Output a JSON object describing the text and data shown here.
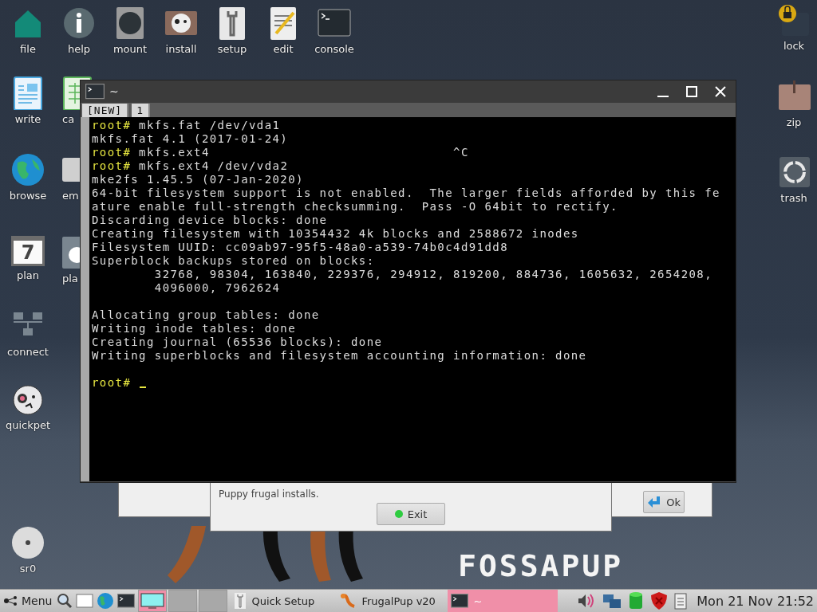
{
  "desktop_icons": [
    {
      "label": "file"
    },
    {
      "label": "help"
    },
    {
      "label": "mount"
    },
    {
      "label": "install"
    },
    {
      "label": "setup"
    },
    {
      "label": "edit"
    },
    {
      "label": "console"
    },
    {
      "label": "lock"
    },
    {
      "label": "write"
    },
    {
      "label": "ca"
    },
    {
      "label": "zip"
    },
    {
      "label": "browse"
    },
    {
      "label": "em"
    },
    {
      "label": "trash"
    },
    {
      "label": "plan",
      "glyph": "7"
    },
    {
      "label": "pla"
    },
    {
      "label": "connect"
    },
    {
      "label": "quickpet"
    },
    {
      "label": "sr0"
    }
  ],
  "dialogs": [
    {
      "text": "Puppy frugal installs.",
      "button": "Exit"
    },
    {
      "button": "Ok"
    }
  ],
  "terminal": {
    "title": "~",
    "tabs": [
      {
        "label": "[NEW]"
      },
      {
        "label": "1"
      }
    ],
    "lines": [
      {
        "kind": "prompt",
        "prompt": "root#",
        "command": "mkfs.fat /dev/vda1"
      },
      {
        "kind": "output",
        "text": "mkfs.fat 4.1 (2017-01-24)"
      },
      {
        "kind": "prompt",
        "prompt": "root#",
        "command": "mkfs.ext4                               ^C"
      },
      {
        "kind": "prompt",
        "prompt": "root#",
        "command": "mkfs.ext4 /dev/vda2"
      },
      {
        "kind": "output",
        "text": "mke2fs 1.45.5 (07-Jan-2020)"
      },
      {
        "kind": "output",
        "text": "64-bit filesystem support is not enabled.  The larger fields afforded by this fe"
      },
      {
        "kind": "output",
        "text": "ature enable full-strength checksumming.  Pass -O 64bit to rectify."
      },
      {
        "kind": "output",
        "text": "Discarding device blocks: done"
      },
      {
        "kind": "output",
        "text": "Creating filesystem with 10354432 4k blocks and 2588672 inodes"
      },
      {
        "kind": "output",
        "text": "Filesystem UUID: cc09ab97-95f5-48a0-a539-74b0c4d91dd8"
      },
      {
        "kind": "output",
        "text": "Superblock backups stored on blocks:"
      },
      {
        "kind": "indented",
        "text": "32768, 98304, 163840, 229376, 294912, 819200, 884736, 1605632, 2654208,"
      },
      {
        "kind": "indented",
        "text": "4096000, 7962624"
      },
      {
        "kind": "blank"
      },
      {
        "kind": "output",
        "text": "Allocating group tables: done"
      },
      {
        "kind": "output",
        "text": "Writing inode tables: done"
      },
      {
        "kind": "output",
        "text": "Creating journal (65536 blocks): done"
      },
      {
        "kind": "output",
        "text": "Writing superblocks and filesystem accounting information: done"
      },
      {
        "kind": "blank"
      },
      {
        "kind": "prompt",
        "prompt": "root#",
        "cursor": true
      }
    ]
  },
  "logo": "FOSSAPUP",
  "taskbar": {
    "menu": "Menu",
    "workspaces": [
      {
        "selected": true
      },
      {
        "selected": false
      },
      {
        "selected": false
      }
    ],
    "tasks": [
      {
        "label": "Quick Setup",
        "selected": false
      },
      {
        "label": "FrugalPup v20",
        "selected": false
      },
      {
        "label": "~",
        "selected": true
      }
    ],
    "clock": "Mon 21 Nov 21:52"
  }
}
